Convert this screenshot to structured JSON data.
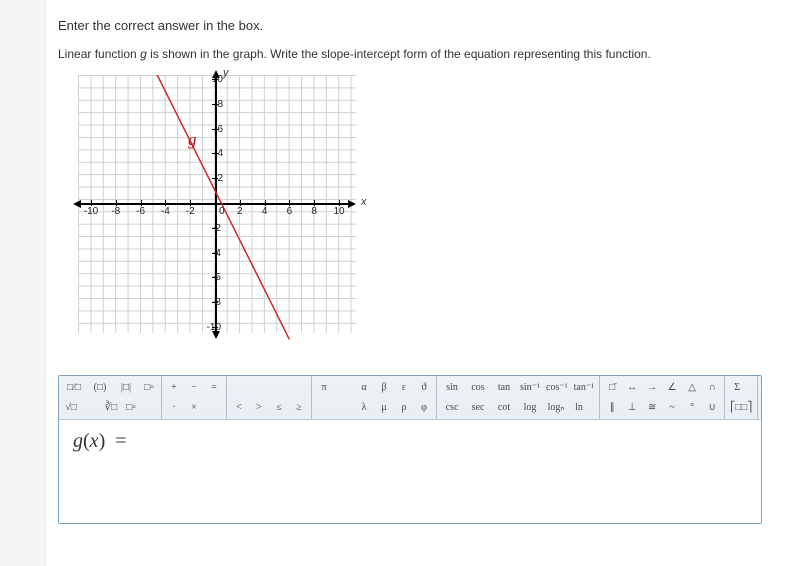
{
  "instruction": "Enter the correct answer in the box.",
  "prompt_html": "Linear function <i>g</i> is shown in the graph. Write the slope-intercept form of the equation representing this function.",
  "chart_data": {
    "type": "line",
    "title": "",
    "xlabel": "x",
    "ylabel": "y",
    "xlim": [
      -11,
      11
    ],
    "ylim": [
      -11,
      11
    ],
    "xticks": [
      -10,
      -8,
      -6,
      -4,
      -2,
      0,
      2,
      4,
      6,
      8,
      10
    ],
    "yticks": [
      -10,
      -8,
      -6,
      -4,
      -2,
      2,
      4,
      6,
      8,
      10
    ],
    "grid": true,
    "series": [
      {
        "name": "g",
        "color": "#cc2a2a",
        "points": [
          [
            -5,
            11
          ],
          [
            0,
            1
          ],
          [
            6,
            -11
          ]
        ],
        "slope": -2,
        "intercept": 1
      }
    ]
  },
  "toolbar": {
    "groups": [
      {
        "rows": [
          [
            "□⁄□",
            "(□)",
            "|□|",
            "□▫"
          ],
          [
            "√□",
            "",
            "∛□",
            "□▫"
          ]
        ]
      },
      {
        "rows": [
          [
            "+",
            "−",
            "="
          ],
          [
            "·",
            "×",
            ""
          ]
        ]
      },
      {
        "rows": [
          [
            "",
            "",
            ""
          ],
          [
            "<",
            ">",
            "≤",
            "≥"
          ]
        ]
      },
      {
        "rows": [
          [
            "π",
            "",
            "α",
            "β",
            "ε",
            "ϑ"
          ],
          [
            "",
            "",
            "λ",
            "μ",
            "ρ",
            "φ"
          ]
        ]
      },
      {
        "rows": [
          [
            "sin",
            "cos",
            "tan",
            "sin⁻¹",
            "cos⁻¹",
            "tan⁻¹"
          ],
          [
            "csc",
            "sec",
            "cot",
            "log",
            "logₙ",
            "ln"
          ]
        ]
      },
      {
        "rows": [
          [
            "□̄",
            "↔",
            "→",
            "∠",
            "△",
            "∩"
          ],
          [
            "∥",
            "⊥",
            "≅",
            "~",
            "°",
            "∪"
          ]
        ]
      },
      {
        "rows": [
          [
            "Σ"
          ],
          [
            "⎡□□⎤"
          ]
        ]
      }
    ]
  },
  "answer_prefix": "g(x) ="
}
